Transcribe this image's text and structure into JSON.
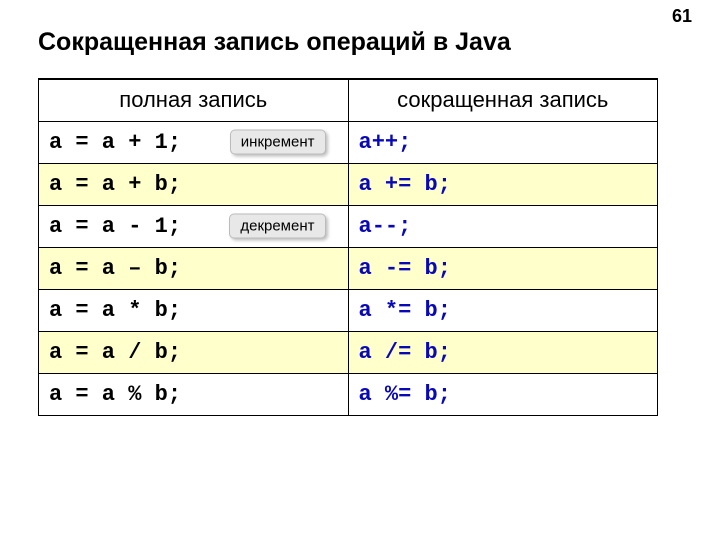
{
  "page_number": "61",
  "title": "Сокращенная запись операций в Java",
  "table": {
    "headers": {
      "full": "полная запись",
      "short": "сокращенная запись"
    },
    "rows": [
      {
        "full": "a = a + 1;",
        "short": "a++;",
        "badge": "инкремент",
        "highlight": false
      },
      {
        "full": "a = a + b;",
        "short": "a += b;",
        "badge": null,
        "highlight": true
      },
      {
        "full": "a = a - 1;",
        "short": "a--;",
        "badge": "декремент",
        "highlight": false
      },
      {
        "full": "a = a – b;",
        "short": "a -= b;",
        "badge": null,
        "highlight": true
      },
      {
        "full": "a = a * b;",
        "short": "a *= b;",
        "badge": null,
        "highlight": false
      },
      {
        "full": "a = a / b;",
        "short": "a /= b;",
        "badge": null,
        "highlight": true
      },
      {
        "full": "a = a % b;",
        "short": "a %= b;",
        "badge": null,
        "highlight": false
      }
    ]
  }
}
